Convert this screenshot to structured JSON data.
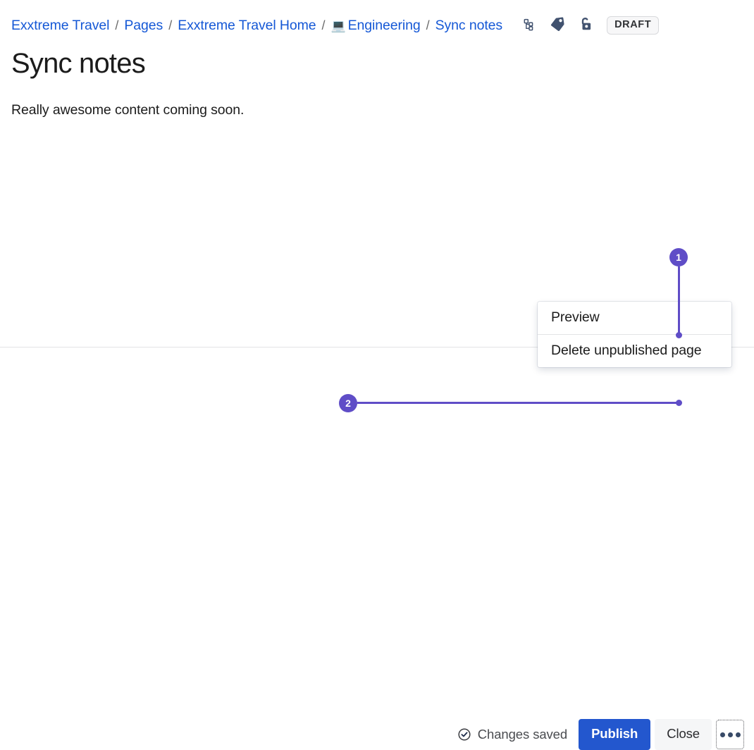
{
  "breadcrumb": {
    "name": "breadcrumb",
    "separator": "/",
    "items": [
      {
        "label": "Exxtreme Travel",
        "emoji": ""
      },
      {
        "label": "Pages",
        "emoji": ""
      },
      {
        "label": "Exxtreme Travel Home",
        "emoji": ""
      },
      {
        "label": "Engineering",
        "emoji": "💻"
      },
      {
        "label": "Sync notes",
        "emoji": ""
      }
    ],
    "icons": [
      {
        "name": "page-tree-icon",
        "title": "Page tree"
      },
      {
        "name": "tag-icon",
        "title": "Labels"
      },
      {
        "name": "unlock-icon",
        "title": "Restrictions"
      }
    ],
    "status_badge": "DRAFT"
  },
  "page": {
    "title": "Sync notes",
    "body": "Really awesome content coming soon."
  },
  "footer": {
    "saved_status": "Changes saved",
    "saved_icon": "check-circle-icon",
    "publish_label": "Publish",
    "close_label": "Close",
    "more_icon": "more-horizontal-icon"
  },
  "dropdown": {
    "items": [
      {
        "label": "Preview"
      },
      {
        "label": "Delete unpublished page"
      }
    ]
  },
  "annotations": [
    {
      "number": "1",
      "target": "dropdown-menu"
    },
    {
      "number": "2",
      "target": "more-actions-button"
    }
  ],
  "colors": {
    "link": "#1558d6",
    "publish_blue": "#2357ce",
    "annotation_purple": "#5f4dc7",
    "icon_navy": "#384a67",
    "text": "#1b1b1b"
  }
}
